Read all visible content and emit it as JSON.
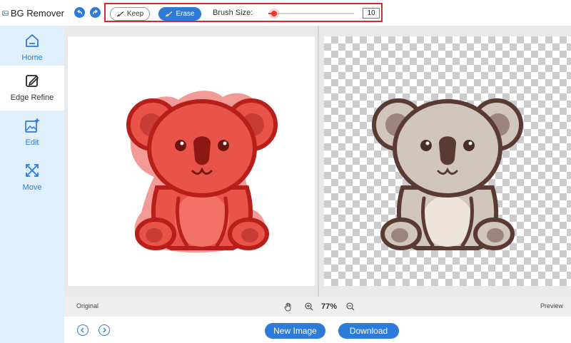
{
  "app": {
    "title": "BG Remover"
  },
  "sidebar": {
    "items": [
      {
        "label": "Home",
        "icon": "home-icon",
        "active": false
      },
      {
        "label": "Edge Refine",
        "icon": "edge-refine-icon",
        "active": true
      },
      {
        "label": "Edit",
        "icon": "edit-image-icon",
        "active": false
      },
      {
        "label": "Move",
        "icon": "move-icon",
        "active": false
      }
    ]
  },
  "toolbar": {
    "undo_icon": "undo-icon",
    "redo_icon": "redo-icon",
    "keep_label": "Keep",
    "erase_label": "Erase",
    "erase_active": true,
    "brush_size_label": "Brush Size:",
    "brush_size_value": "10",
    "brush_slider_level": 0.07
  },
  "status": {
    "original_label": "Original",
    "preview_label": "Preview",
    "zoom": "77%",
    "hand_icon": "hand-icon",
    "zoom_in_icon": "zoom-in-icon",
    "zoom_out_icon": "zoom-out-icon"
  },
  "bottom": {
    "new_image_label": "New Image",
    "download_label": "Download",
    "prev_icon": "chevron-left-icon",
    "next_icon": "chevron-right-icon"
  },
  "colors": {
    "accent": "#2e7ad8",
    "highlight_box": "#d9292f",
    "erase_mask": "#e8493f",
    "slider_active": "#ea3b2e",
    "sidebar_bg": "#dfeffc",
    "koala_fur": "#d1c6bc",
    "koala_outline": "#5a3b34"
  }
}
